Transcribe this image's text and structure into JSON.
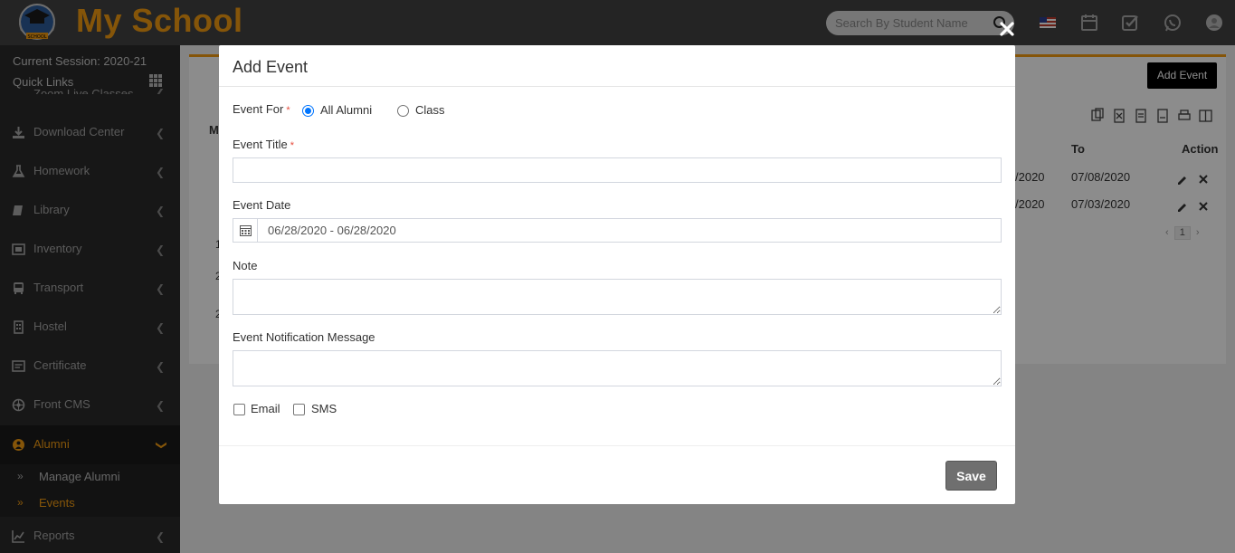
{
  "header": {
    "brand": "My School",
    "logo_text": "SCHOOL",
    "search_placeholder": "Search By Student Name"
  },
  "sidebar": {
    "session": "Current Session: 2020-21",
    "quick_links": "Quick Links",
    "items": [
      {
        "label": "Zoom Live Classes",
        "icon": "video-icon"
      },
      {
        "label": "Download Center",
        "icon": "download-icon"
      },
      {
        "label": "Homework",
        "icon": "flask-icon"
      },
      {
        "label": "Library",
        "icon": "book-icon"
      },
      {
        "label": "Inventory",
        "icon": "box-icon"
      },
      {
        "label": "Transport",
        "icon": "bus-icon"
      },
      {
        "label": "Hostel",
        "icon": "building-icon"
      },
      {
        "label": "Certificate",
        "icon": "certificate-icon"
      },
      {
        "label": "Front CMS",
        "icon": "cms-icon"
      },
      {
        "label": "Alumni",
        "icon": "alumni-icon"
      },
      {
        "label": "Reports",
        "icon": "line-chart-icon"
      }
    ],
    "alumni_sub": [
      {
        "label": "Manage Alumni"
      },
      {
        "label": "Events"
      }
    ]
  },
  "background": {
    "add_event_button": "Add Event",
    "columns": {
      "to": "To",
      "action": "Action",
      "m": "M"
    },
    "rows": [
      {
        "from_tail": "/2020",
        "to": "07/08/2020"
      },
      {
        "from_tail": "/2020",
        "to": "07/03/2020"
      }
    ],
    "left_col": [
      "1",
      "2",
      "2"
    ],
    "page": "1"
  },
  "modal": {
    "title": "Add Event",
    "event_for_label": "Event For",
    "required_mark": "*",
    "options": [
      {
        "label": "All Alumni",
        "checked": true
      },
      {
        "label": "Class",
        "checked": false
      }
    ],
    "event_title_label": "Event Title",
    "event_title_value": "",
    "event_date_label": "Event Date",
    "event_date_value": "06/28/2020 - 06/28/2020",
    "note_label": "Note",
    "note_value": "",
    "notification_label": "Event Notification Message",
    "notification_value": "",
    "checkboxes": [
      {
        "label": "Email",
        "checked": false
      },
      {
        "label": "SMS",
        "checked": false
      }
    ],
    "save_label": "Save"
  },
  "colors": {
    "accent": "#f39c12",
    "header_bg": "#424242",
    "sidebar_bg": "#2b2b2b",
    "radio_blue": "#0075ff",
    "save_bg": "#6f6f6f"
  }
}
